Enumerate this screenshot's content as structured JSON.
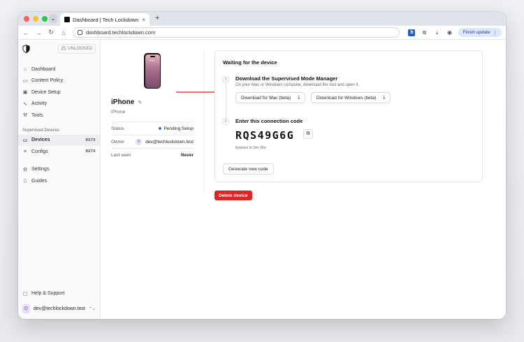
{
  "browser": {
    "tab_title": "Dashboard | Tech Lockdown",
    "tab_close": "×",
    "new_tab": "+",
    "url": "dashboard.techlockdown.com",
    "finish_update": "Finish update",
    "nav_back": "←",
    "nav_forward": "→",
    "nav_reload": "↻",
    "nav_home": "⌂",
    "ext_bitwarden": "b",
    "ext_puzzle": "⧉",
    "download_icon": "⤓",
    "profile_icon": "◉",
    "menu_icon": "⋮",
    "tab_dropdown": "⌄"
  },
  "sidebar": {
    "lock_status": "UNLOCKED",
    "lock_icon": "🔓",
    "items": [
      {
        "label": "Dashboard",
        "icon": "⌂"
      },
      {
        "label": "Content Policy",
        "icon": "▭"
      },
      {
        "label": "Device Setup",
        "icon": "▣"
      },
      {
        "label": "Activity",
        "icon": "∿"
      },
      {
        "label": "Tools",
        "icon": "⚒"
      }
    ],
    "section_title": "Supervised Devices",
    "supervised_items": [
      {
        "label": "Devices",
        "icon": "▭",
        "badge": "BETA"
      },
      {
        "label": "Configs",
        "icon": "≡",
        "badge": "BETA"
      }
    ],
    "bottom_items": [
      {
        "label": "Settings",
        "icon": "⚙"
      },
      {
        "label": "Guides",
        "icon": "▯"
      }
    ],
    "help": {
      "label": "Help & Support",
      "icon": "▢"
    },
    "user": {
      "initial": "D",
      "email": "dev@techlockdown.test",
      "caret": "⌃⌄"
    }
  },
  "device": {
    "screen_time": "9:41",
    "name": "iPhone",
    "edit_icon": "✎",
    "model": "iPhone",
    "status_label": "Status",
    "status_value": "Pending Setup",
    "owner_label": "Owner",
    "owner_initial": "D",
    "owner_value": "dev@techlockdown.test",
    "last_seen_label": "Last seen",
    "last_seen_value": "Never",
    "status_color": "#2f6fde"
  },
  "waiting": {
    "title": "Waiting for the device",
    "step1": {
      "num": "1",
      "title": "Download the Supervised Mode Manager",
      "desc": "On your Mac or Windows computer, download the tool and open it.",
      "mac_button": "Download for Mac (beta)",
      "win_button": "Download for Windows (beta)",
      "download_icon": "⤓"
    },
    "step2": {
      "num": "2",
      "title": "Enter this connection code",
      "code": "RQS49G6G",
      "copy_icon": "⧉",
      "expires": "Expires in 9m 26s"
    },
    "generate_button": "Generate new code"
  },
  "delete_button": "Delete device",
  "colors": {
    "accent_red": "#dc2626",
    "arrow_red": "#e8412f",
    "active_nav_bg": "#eceef1"
  }
}
